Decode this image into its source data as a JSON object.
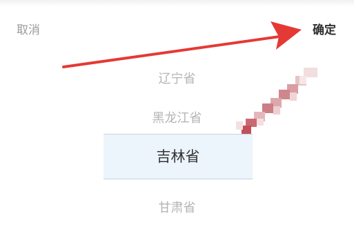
{
  "toolbar": {
    "cancel_label": "取消",
    "confirm_label": "确定"
  },
  "picker": {
    "items": [
      {
        "label": "辽宁省"
      },
      {
        "label": "黑龙江省"
      },
      {
        "label": "吉林省",
        "selected": true
      },
      {
        "label": "甘肃省"
      }
    ]
  },
  "colors": {
    "annotation_arrow": "#e53935",
    "selected_background": "#ecf4fc",
    "unselected_text": "#b4b4b4"
  },
  "icons": {
    "annotation": "red-arrow-icon",
    "redaction": "pixelated-mosaic"
  }
}
